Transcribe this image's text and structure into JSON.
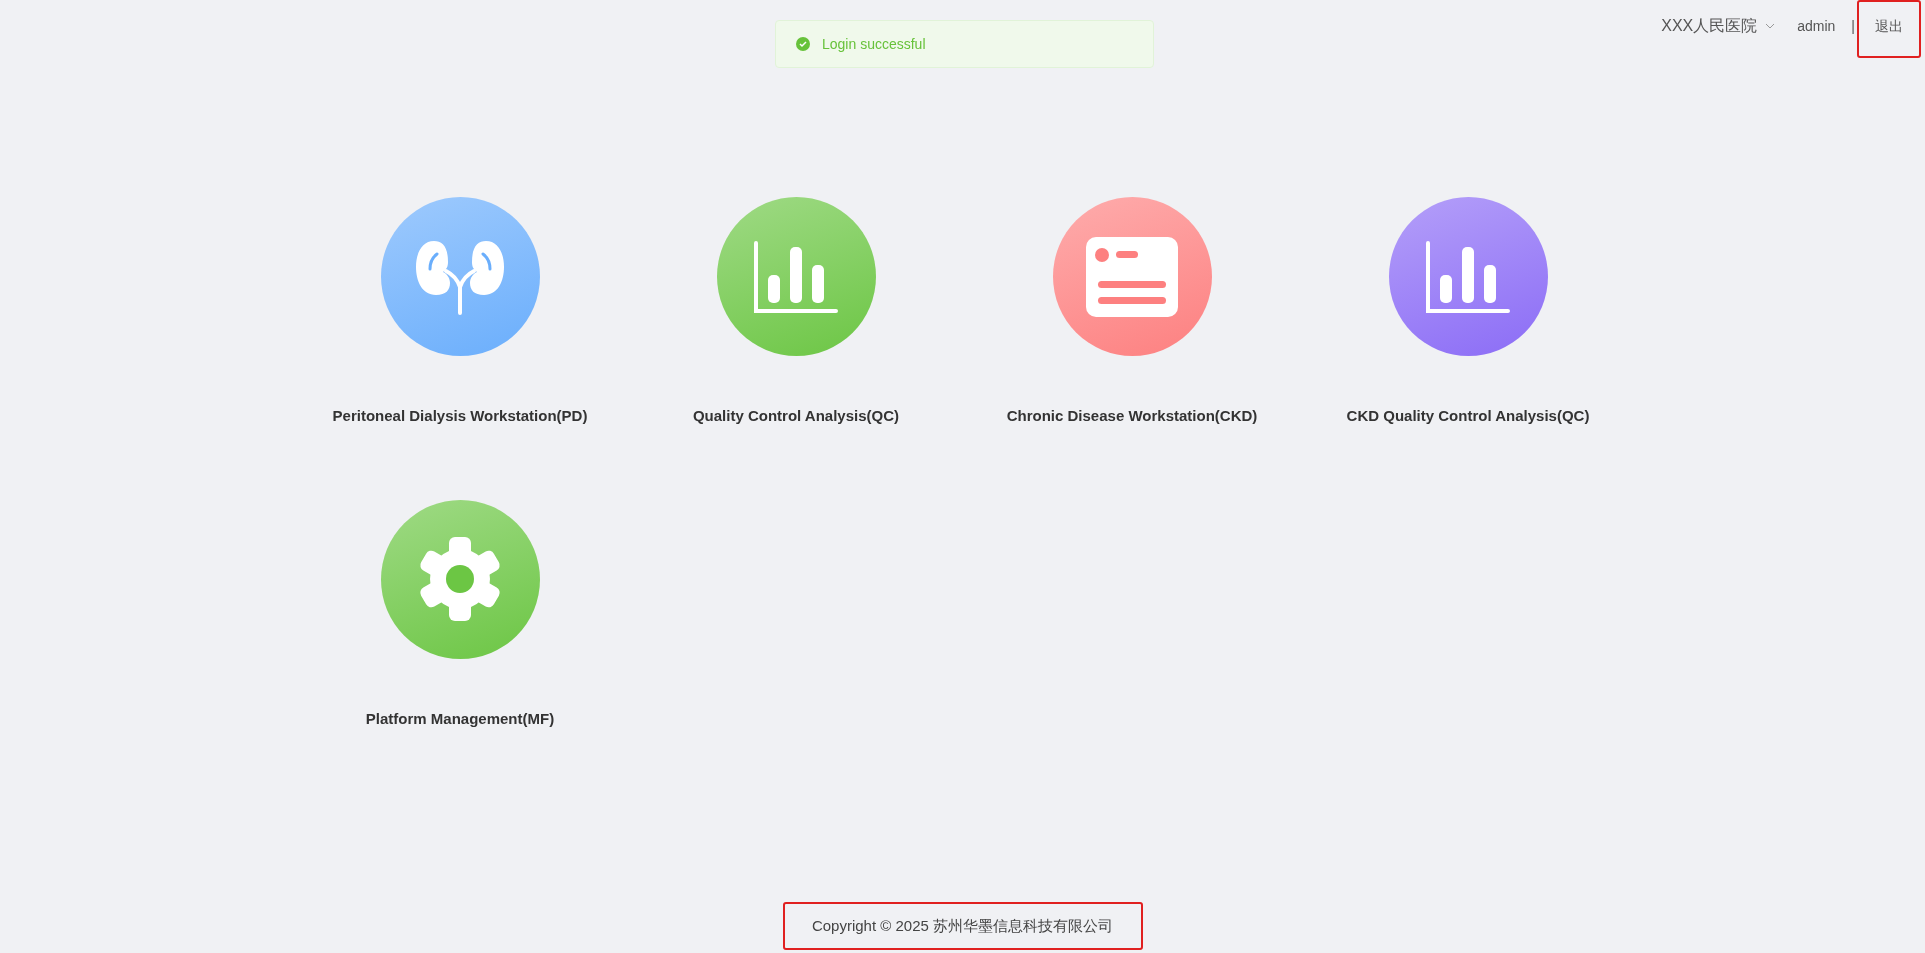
{
  "toast": {
    "kind": "success",
    "message": "Login successful"
  },
  "header": {
    "hospital": "XXX人民医院",
    "user": "admin",
    "separator": "|",
    "logout": {
      "label": "退出",
      "highlighted": true
    }
  },
  "modules": [
    {
      "label": "Peritoneal Dialysis Workstation(PD)",
      "kind": "kidney",
      "color": "#6aaefc"
    },
    {
      "label": "Quality Control Analysis(QC)",
      "kind": "chart",
      "color": "#6cc644"
    },
    {
      "label": "Chronic Disease Workstation(CKD)",
      "kind": "card",
      "color": "#fd8080"
    },
    {
      "label": "CKD Quality Control Analysis(QC)",
      "kind": "chart",
      "color": "#8b6cf6"
    },
    {
      "label": "Platform Management(MF)",
      "kind": "gear",
      "color": "#6cc644"
    }
  ],
  "footer": {
    "text": "Copyright © 2025 苏州华墨信息科技有限公司",
    "highlighted": true
  }
}
